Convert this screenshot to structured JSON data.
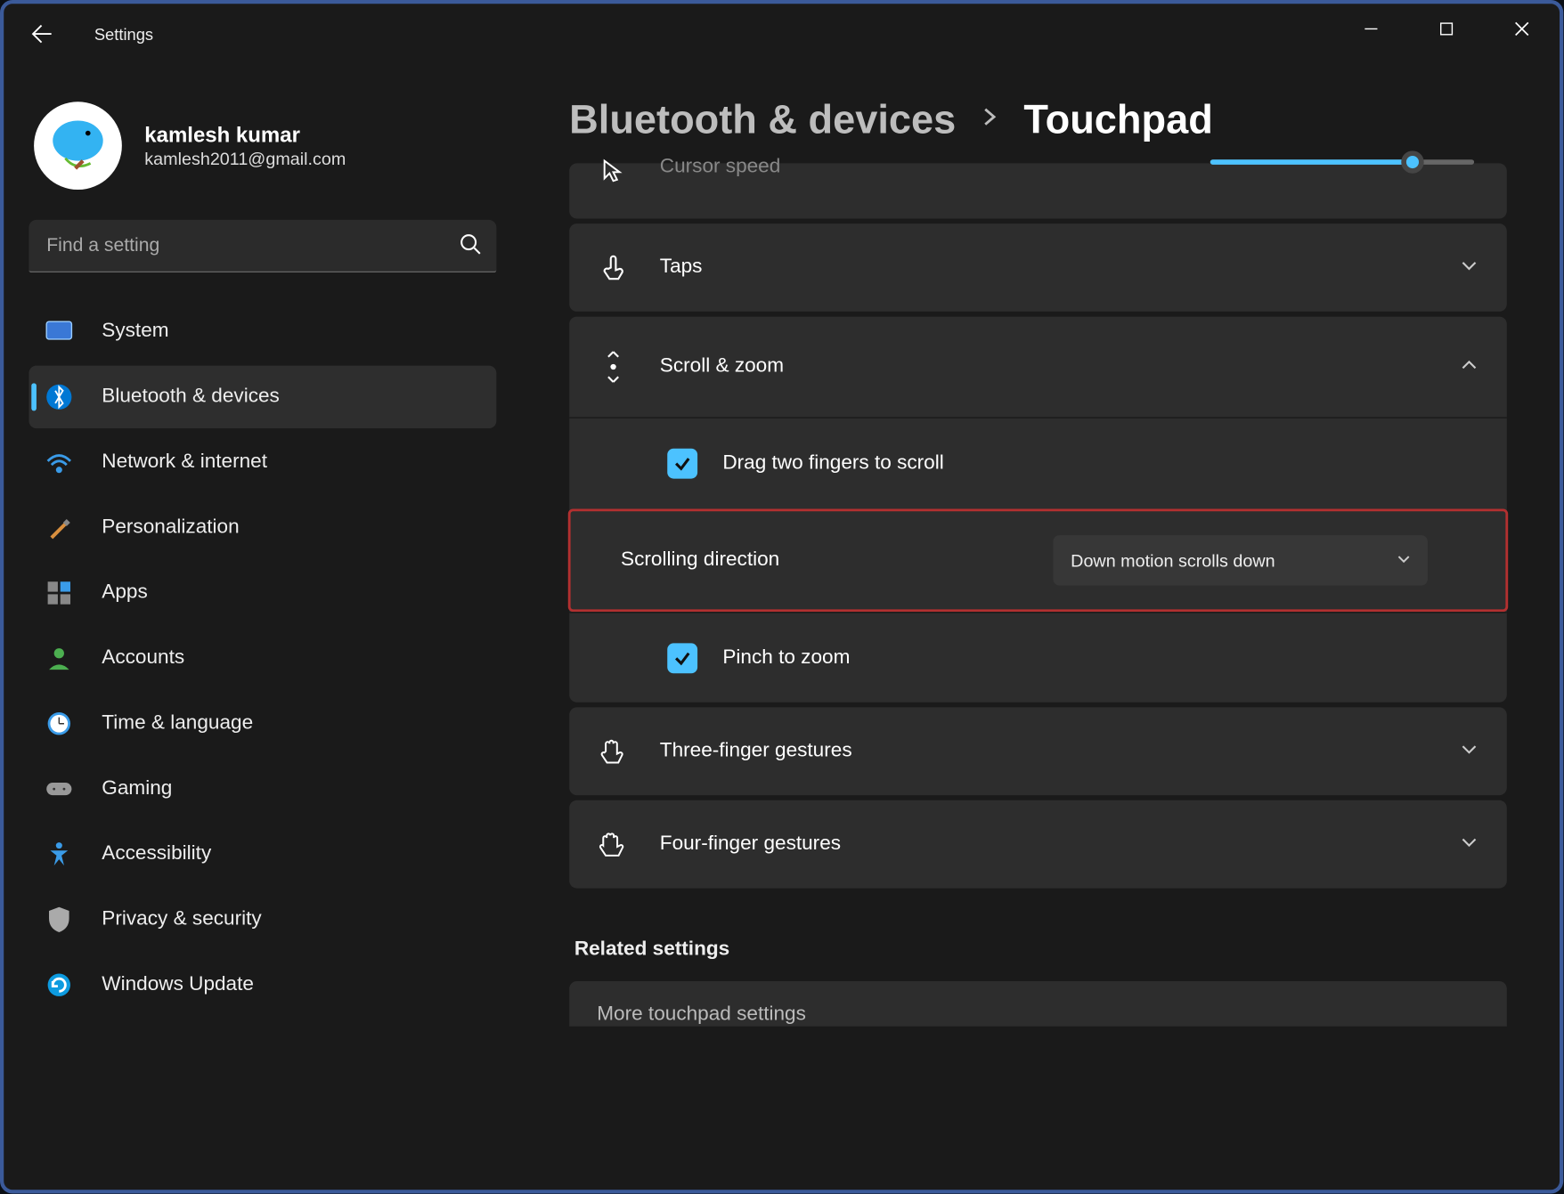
{
  "window": {
    "title": "Settings"
  },
  "profile": {
    "name": "kamlesh kumar",
    "email": "kamlesh2011@gmail.com"
  },
  "search": {
    "placeholder": "Find a setting"
  },
  "nav": {
    "items": [
      {
        "label": "System"
      },
      {
        "label": "Bluetooth & devices"
      },
      {
        "label": "Network & internet"
      },
      {
        "label": "Personalization"
      },
      {
        "label": "Apps"
      },
      {
        "label": "Accounts"
      },
      {
        "label": "Time & language"
      },
      {
        "label": "Gaming"
      },
      {
        "label": "Accessibility"
      },
      {
        "label": "Privacy & security"
      },
      {
        "label": "Windows Update"
      }
    ]
  },
  "breadcrumb": {
    "parent": "Bluetooth & devices",
    "current": "Touchpad"
  },
  "settings": {
    "cursor_speed": {
      "label": "Cursor speed"
    },
    "taps": {
      "label": "Taps"
    },
    "scroll_zoom": {
      "label": "Scroll & zoom",
      "drag_two": "Drag two fingers to scroll",
      "direction_label": "Scrolling direction",
      "direction_value": "Down motion scrolls down",
      "pinch": "Pinch to zoom"
    },
    "three_finger": {
      "label": "Three-finger gestures"
    },
    "four_finger": {
      "label": "Four-finger gestures"
    }
  },
  "related": {
    "heading": "Related settings",
    "more": "More touchpad settings"
  }
}
